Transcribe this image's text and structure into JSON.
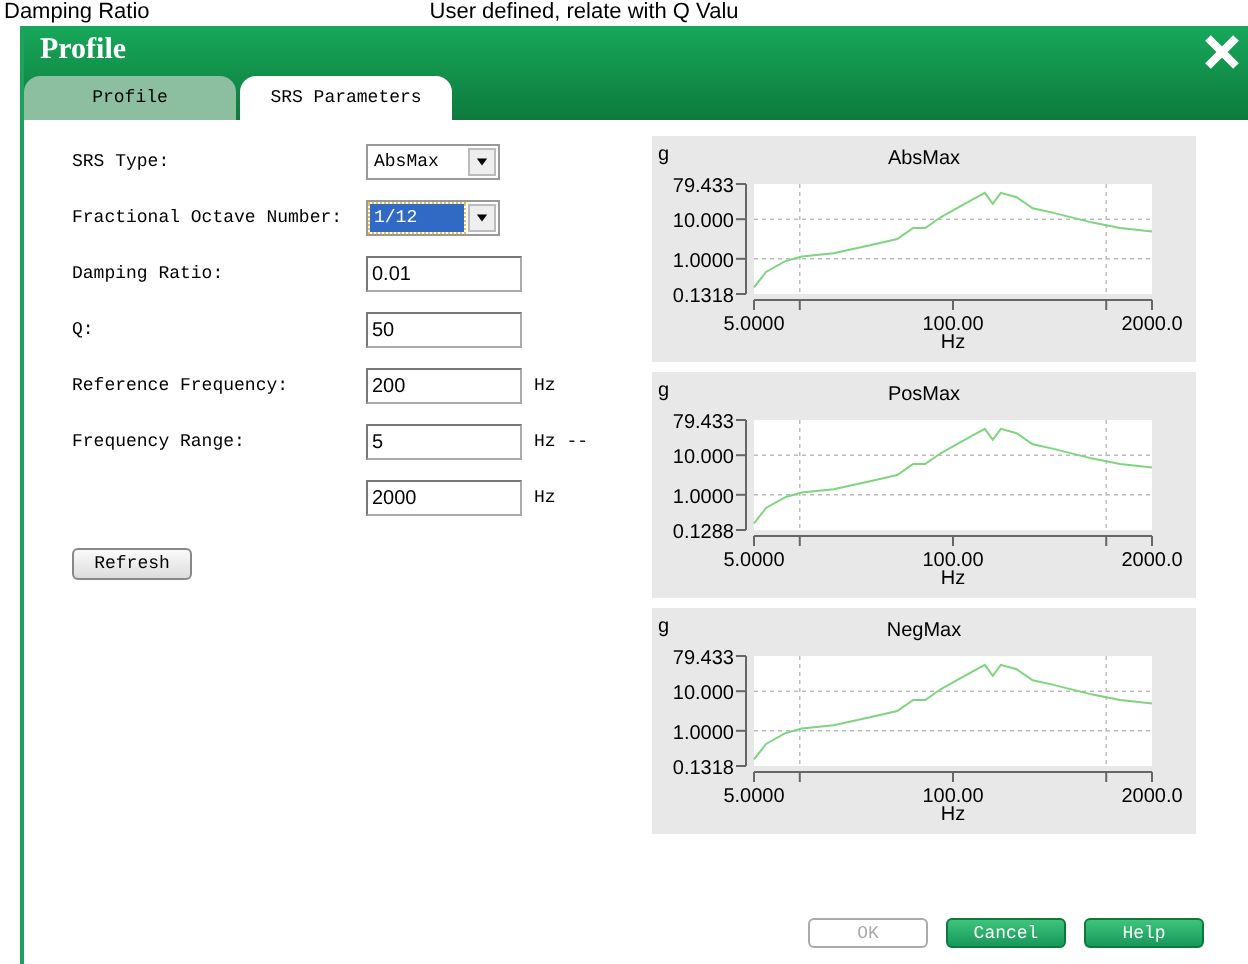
{
  "background_text": [
    "Damping Ratio",
    "User defined, relate with Q Valu"
  ],
  "window": {
    "title": "Profile"
  },
  "tabs": [
    {
      "label": "Profile",
      "selected": false
    },
    {
      "label": "SRS Parameters",
      "selected": true
    }
  ],
  "form": [
    {
      "label": "SRS Type:",
      "kind": "select",
      "value": "AbsMax",
      "focused": false
    },
    {
      "label": "Fractional Octave Number:",
      "kind": "select",
      "value": "1/12",
      "focused": true
    },
    {
      "label": "Damping Ratio:",
      "kind": "text",
      "value": "0.01"
    },
    {
      "label": "Q:",
      "kind": "text",
      "value": "50"
    },
    {
      "label": "Reference Frequency:",
      "kind": "text",
      "value": "200",
      "unit": "Hz"
    },
    {
      "label": "Frequency Range:",
      "kind": "text",
      "value": "5",
      "unit": "Hz --"
    },
    {
      "kind": "text",
      "value": "2000",
      "unit": "Hz"
    }
  ],
  "refresh_button": "Refresh",
  "charts": [
    {
      "title": "AbsMax",
      "ylabel": "g",
      "xlabel": "Hz",
      "y_tick_labels": [
        "79.433",
        "10.000",
        "1.0000",
        "0.1318"
      ],
      "x_tick_labels": [
        "5.0000",
        "100.00",
        "2000.0"
      ]
    },
    {
      "title": "PosMax",
      "ylabel": "g",
      "xlabel": "Hz",
      "y_tick_labels": [
        "79.433",
        "10.000",
        "1.0000",
        "0.1288"
      ],
      "x_tick_labels": [
        "5.0000",
        "100.00",
        "2000.0"
      ]
    },
    {
      "title": "NegMax",
      "ylabel": "g",
      "xlabel": "Hz",
      "y_tick_labels": [
        "79.433",
        "10.000",
        "1.0000",
        "0.1318"
      ],
      "x_tick_labels": [
        "5.0000",
        "100.00",
        "2000.0"
      ]
    }
  ],
  "buttons": [
    {
      "label": "OK",
      "disabled": true
    },
    {
      "label": "Cancel",
      "disabled": false
    },
    {
      "label": "Help",
      "disabled": false
    }
  ]
}
